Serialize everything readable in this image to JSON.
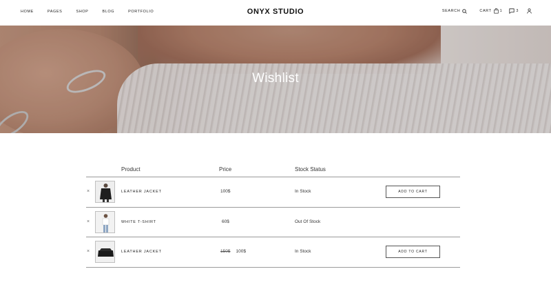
{
  "header": {
    "nav": [
      "HOME",
      "PAGES",
      "SHOP",
      "BLOG",
      "PORTFOLIO"
    ],
    "brand": "ONYX STUDIO",
    "search_label": "SEARCH",
    "cart_label": "CART",
    "cart_count": "1",
    "wishlist_count": "3",
    "icons": [
      "search-icon",
      "shopping-bag-icon",
      "wishlist-icon",
      "user-icon"
    ]
  },
  "hero": {
    "title": "Wishlist"
  },
  "table": {
    "headers": {
      "product": "Product",
      "price": "Price",
      "stock": "Stock Status"
    },
    "rows": [
      {
        "remove": "×",
        "name": "LEATHER JACKET",
        "price": "100$",
        "old_price": "",
        "stock": "In Stock",
        "button": "ADD TO CART"
      },
      {
        "remove": "×",
        "name": "WHITE T-SHIRT",
        "price": "60$",
        "old_price": "",
        "stock": "Out Of Stock",
        "button": ""
      },
      {
        "remove": "×",
        "name": "LEATHER JACKET",
        "price": "100$",
        "old_price": "150$",
        "stock": "In Stock",
        "button": "ADD TO CART"
      }
    ]
  }
}
